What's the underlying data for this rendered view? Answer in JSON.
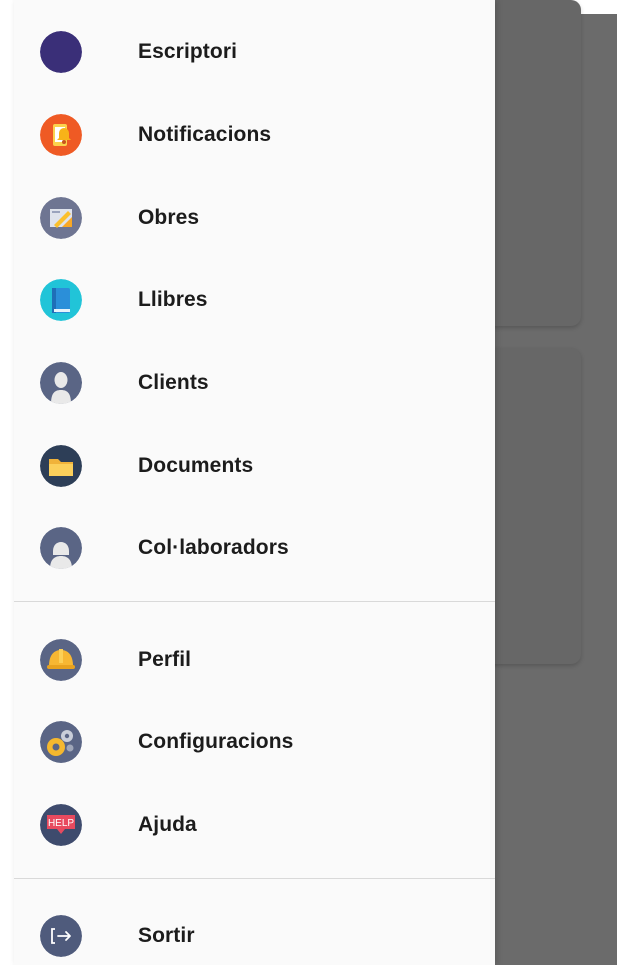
{
  "drawer": {
    "primary_items": [
      {
        "label": "Escriptori",
        "icon": "dashboard-icon"
      },
      {
        "label": "Notificacions",
        "icon": "bell-icon"
      },
      {
        "label": "Obres",
        "icon": "blueprint-icon"
      },
      {
        "label": "Llibres",
        "icon": "book-icon"
      },
      {
        "label": "Clients",
        "icon": "client-icon"
      },
      {
        "label": "Documents",
        "icon": "folder-icon"
      },
      {
        "label": "Col·laboradors",
        "icon": "collaborator-icon"
      }
    ],
    "secondary_items": [
      {
        "label": "Perfil",
        "icon": "hardhat-icon"
      },
      {
        "label": "Configuracions",
        "icon": "gears-icon"
      },
      {
        "label": "Ajuda",
        "icon": "help-icon",
        "badge_text": "HELP"
      }
    ],
    "footer_items": [
      {
        "label": "Sortir",
        "icon": "logout-icon"
      }
    ]
  },
  "colors": {
    "drawer_bg": "#fafafa",
    "scrim": "#6b6b6b",
    "label": "#1c1c1c",
    "divider": "#d9d9d9"
  }
}
